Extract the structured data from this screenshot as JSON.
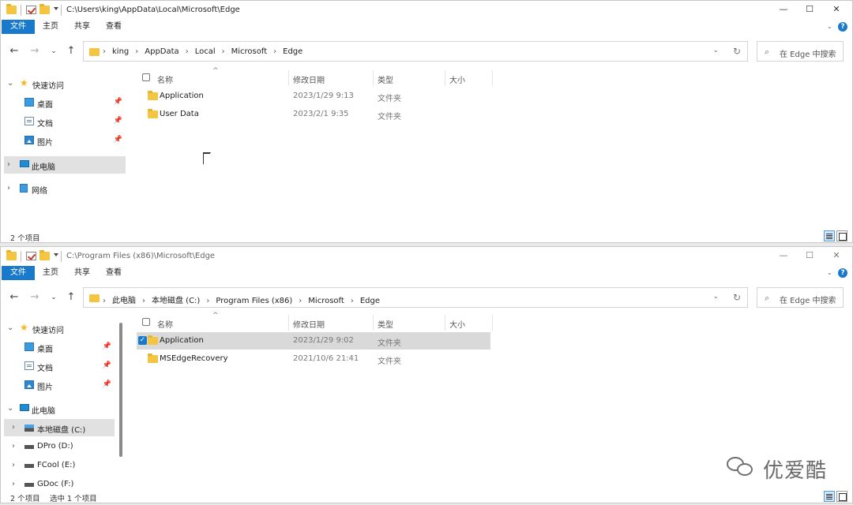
{
  "top_window": {
    "title_path": "C:\\Users\\king\\AppData\\Local\\Microsoft\\Edge",
    "ribbon": [
      "文件",
      "主页",
      "共享",
      "查看"
    ],
    "breadcrumbs": [
      "king",
      "AppData",
      "Local",
      "Microsoft",
      "Edge"
    ],
    "search_placeholder": "在 Edge 中搜索",
    "sidebar": {
      "quick_access": "快速访问",
      "desktop": "桌面",
      "documents": "文档",
      "pictures": "图片",
      "this_pc": "此电脑",
      "network": "网络"
    },
    "columns": {
      "name": "名称",
      "date": "修改日期",
      "type": "类型",
      "size": "大小"
    },
    "rows": [
      {
        "name": "Application",
        "date": "2023/1/29 9:13",
        "type": "文件夹"
      },
      {
        "name": "User Data",
        "date": "2023/2/1 9:35",
        "type": "文件夹"
      }
    ],
    "status": "2 个项目"
  },
  "bottom_window": {
    "title_path": "C:\\Program Files (x86)\\Microsoft\\Edge",
    "ribbon": [
      "文件",
      "主页",
      "共享",
      "查看"
    ],
    "breadcrumbs": [
      "此电脑",
      "本地磁盘 (C:)",
      "Program Files (x86)",
      "Microsoft",
      "Edge"
    ],
    "search_placeholder": "在 Edge 中搜索",
    "sidebar": {
      "quick_access": "快速访问",
      "desktop": "桌面",
      "documents": "文档",
      "pictures": "图片",
      "this_pc": "此电脑",
      "drive_c": "本地磁盘 (C:)",
      "drive_d": "DPro (D:)",
      "drive_e": "FCool (E:)",
      "drive_f": "GDoc (F:)"
    },
    "columns": {
      "name": "名称",
      "date": "修改日期",
      "type": "类型",
      "size": "大小"
    },
    "rows": [
      {
        "name": "Application",
        "date": "2023/1/29 9:02",
        "type": "文件夹",
        "selected": true
      },
      {
        "name": "MSEdgeRecovery",
        "date": "2021/10/6 21:41",
        "type": "文件夹"
      }
    ],
    "status": "2 个项目",
    "status_selection": "选中 1 个项目"
  },
  "watermark": "优爱酷",
  "colors": {
    "accent": "#1979ca",
    "folder": "#f4c541",
    "selection": "#d9d9d9"
  }
}
